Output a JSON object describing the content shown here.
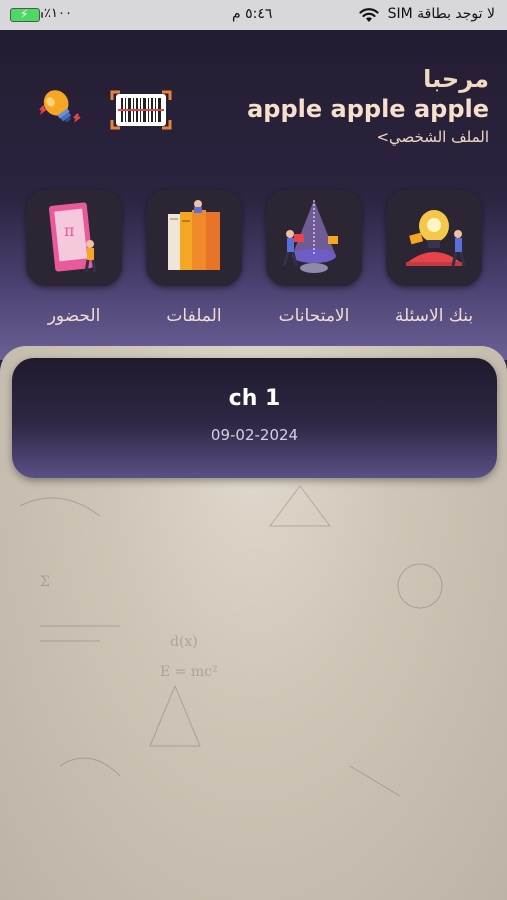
{
  "status_bar": {
    "carrier": "لا توجد بطاقة SIM",
    "time": "٥:٤٦ م",
    "battery_percent": "٪١٠٠"
  },
  "greeting": {
    "hello": "مرحبا",
    "name": "apple apple apple",
    "profile_link": "الملف الشخصي>"
  },
  "top_icons": [
    "lightbulb-icon",
    "barcode-scanner-icon"
  ],
  "categories": [
    {
      "label": "بنك الاسئلة",
      "icon": "question-bank-icon"
    },
    {
      "label": "الامتحانات",
      "icon": "exams-icon"
    },
    {
      "label": "الملفات",
      "icon": "files-icon"
    },
    {
      "label": "الحضور",
      "icon": "attendance-icon"
    }
  ],
  "chapters": [
    {
      "title": "ch 1",
      "date": "09-02-2024"
    }
  ],
  "colors": {
    "header_dark": "#221b2e",
    "header_light": "#6b6095",
    "tile_bg": "#2c2533",
    "text_peach": "#f2d9c2",
    "paper": "#cfc6b8"
  }
}
